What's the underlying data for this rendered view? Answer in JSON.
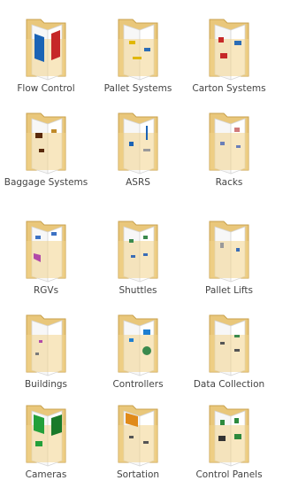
{
  "folders": [
    {
      "label": "Flow Control",
      "accents": [
        "#1b63b5",
        "#c62828"
      ]
    },
    {
      "label": "Pallet Systems",
      "accents": [
        "#e0b700",
        "#2c6db6"
      ]
    },
    {
      "label": "Carton Systems",
      "accents": [
        "#c62828",
        "#2c6db6"
      ]
    },
    {
      "label": "Baggage Systems",
      "accents": [
        "#5a2a0c",
        "#c08a2a"
      ]
    },
    {
      "label": "ASRS",
      "accents": [
        "#1b63b5",
        "#9a9a9a"
      ]
    },
    {
      "label": "Racks",
      "accents": [
        "#6a7fb8",
        "#d07a7a"
      ]
    },
    {
      "label": "RGVs",
      "accents": [
        "#3d72c4",
        "#b24aa8"
      ]
    },
    {
      "label": "Shuttles",
      "accents": [
        "#3b8a4d",
        "#3b6db6"
      ]
    },
    {
      "label": "Pallet Lifts",
      "accents": [
        "#9a9a9a",
        "#3b6db6"
      ]
    },
    {
      "label": "Buildings",
      "accents": [
        "#b24aa8",
        "#7a7a7a"
      ]
    },
    {
      "label": "Controllers",
      "accents": [
        "#1f7fd1",
        "#3b8a4d"
      ]
    },
    {
      "label": "Data Collection",
      "accents": [
        "#3b8a4d",
        "#555555"
      ]
    },
    {
      "label": "Cameras",
      "accents": [
        "#23a03a",
        "#1a7a2a"
      ]
    },
    {
      "label": "Sortation",
      "accents": [
        "#e08a1a",
        "#555555"
      ]
    },
    {
      "label": "Control Panels",
      "accents": [
        "#2d8a3d",
        "#333333"
      ]
    }
  ]
}
